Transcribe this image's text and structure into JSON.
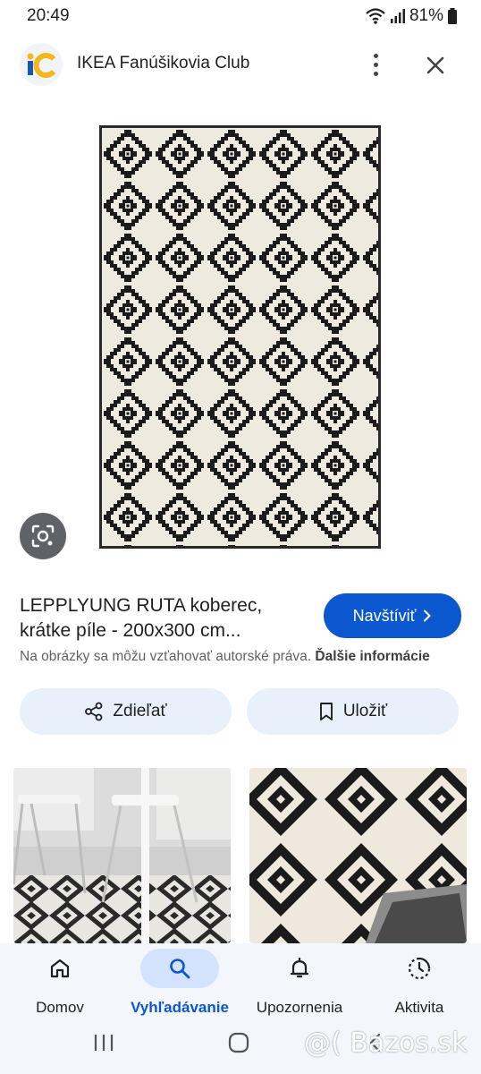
{
  "status": {
    "time": "20:49",
    "battery": "81%"
  },
  "header": {
    "logo_text": "iC",
    "site_title": "IKEA Fanúšikovia Club",
    "more_icon": "more-vert-icon",
    "close_icon": "close-icon"
  },
  "result": {
    "title_line1": "LEPPLYUNG RUTA koberec,",
    "title_line2": "krátke píle - 200x300 cm...",
    "visit_label": "Navštíviť",
    "copyright_text": "Na obrázky sa môžu vzťahovať autorské práva.",
    "more_info_label": "Ďalšie informácie"
  },
  "actions": {
    "share_label": "Zdieľať",
    "save_label": "Uložiť"
  },
  "bottom_nav": {
    "items": [
      {
        "label": "Domov",
        "icon": "home-icon"
      },
      {
        "label": "Vyhľadávanie",
        "icon": "search-icon"
      },
      {
        "label": "Upozornenia",
        "icon": "bell-icon"
      },
      {
        "label": "Aktivita",
        "icon": "activity-icon"
      }
    ]
  },
  "system_nav": {
    "icons": [
      "recents-icon",
      "home-circle-icon",
      "back-icon"
    ]
  },
  "watermark": "@( Bazos.sk",
  "colors": {
    "accent": "#0b57d0",
    "chip_bg": "#e8f0fb",
    "nav_bg": "#f3f6fb",
    "rug_dark": "#1b1b1b",
    "rug_light": "#efeadf"
  }
}
